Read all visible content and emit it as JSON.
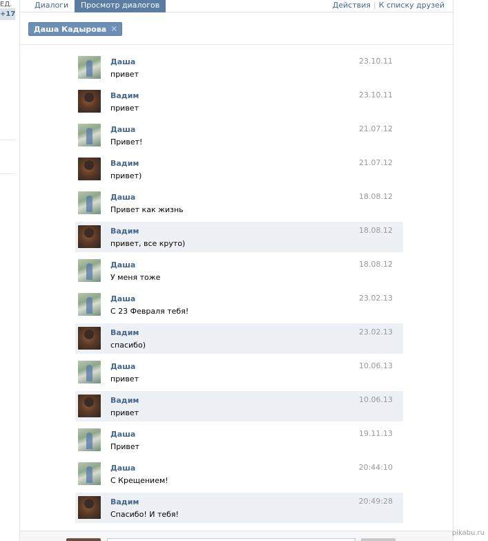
{
  "left": {
    "fragment_text": "ЕД.",
    "badge": "+17"
  },
  "tabs": [
    {
      "label": "Диалоги"
    },
    {
      "label": "Просмотр диалогов"
    }
  ],
  "actions": {
    "actions_label": "Действия",
    "friends_label": "К списку друзей"
  },
  "filter": {
    "name": "Даша Кадырова",
    "close_icon": "close-icon"
  },
  "messages": [
    {
      "author": "Даша",
      "text": "привет",
      "date": "23.10.11",
      "unread": false
    },
    {
      "author": "Вадим",
      "text": "привет",
      "date": "23.10.11",
      "unread": false
    },
    {
      "author": "Даша",
      "text": "Привет!",
      "date": "21.07.12",
      "unread": false
    },
    {
      "author": "Вадим",
      "text": "привет)",
      "date": "21.07.12",
      "unread": false
    },
    {
      "author": "Даша",
      "text": "Привет как жизнь",
      "date": "18.08.12",
      "unread": false
    },
    {
      "author": "Вадим",
      "text": "привет, все круто)",
      "date": "18.08.12",
      "unread": true
    },
    {
      "author": "Даша",
      "text": "У меня тоже",
      "date": "18.08.12",
      "unread": false
    },
    {
      "author": "Даша",
      "text": "С 23 Февраля тебя!",
      "date": "23.02.13",
      "unread": false
    },
    {
      "author": "Вадим",
      "text": "спасибо)",
      "date": "23.02.13",
      "unread": true
    },
    {
      "author": "Даша",
      "text": "привет",
      "date": "10.06.13",
      "unread": false
    },
    {
      "author": "Вадим",
      "text": "привет",
      "date": "10.06.13",
      "unread": true
    },
    {
      "author": "Даша",
      "text": "Привет",
      "date": "19.11.13",
      "unread": false
    },
    {
      "author": "Даша",
      "text": "С Крещением!",
      "date": "20:44:10",
      "unread": false
    },
    {
      "author": "Вадим",
      "text": "Спасибо! И тебя!",
      "date": "20:49:28",
      "unread": true
    }
  ],
  "watermark": "pikabu.ru",
  "colors": {
    "link": "#45688e",
    "active_tab": "#597da3",
    "unread_bg": "#edf1f5",
    "filter_bg": "#6d8fb3"
  }
}
